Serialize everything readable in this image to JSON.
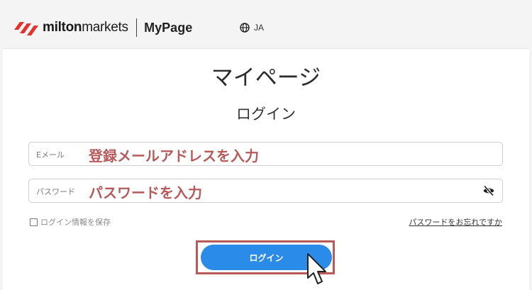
{
  "header": {
    "brand_bold": "milton",
    "brand_light": "markets",
    "section": "MyPage",
    "language": "JA",
    "icons": {
      "logo": "miltonmarkets-logo",
      "language": "globe-icon"
    }
  },
  "main": {
    "title": "マイページ",
    "subtitle": "ログイン",
    "email": {
      "placeholder": "Eメール",
      "annotation": "登録メールアドレスを入力"
    },
    "password": {
      "placeholder": "パスワード",
      "annotation": "パスワードを入力",
      "toggle_icon": "eye-slash-icon"
    },
    "remember_label": "ログイン情報を保存",
    "forgot_link": "パスワードをお忘れですか",
    "login_button": "ログイン"
  },
  "colors": {
    "accent": "#2b8be8",
    "annotation": "#b85a5a",
    "logo_red": "#e4322b"
  }
}
